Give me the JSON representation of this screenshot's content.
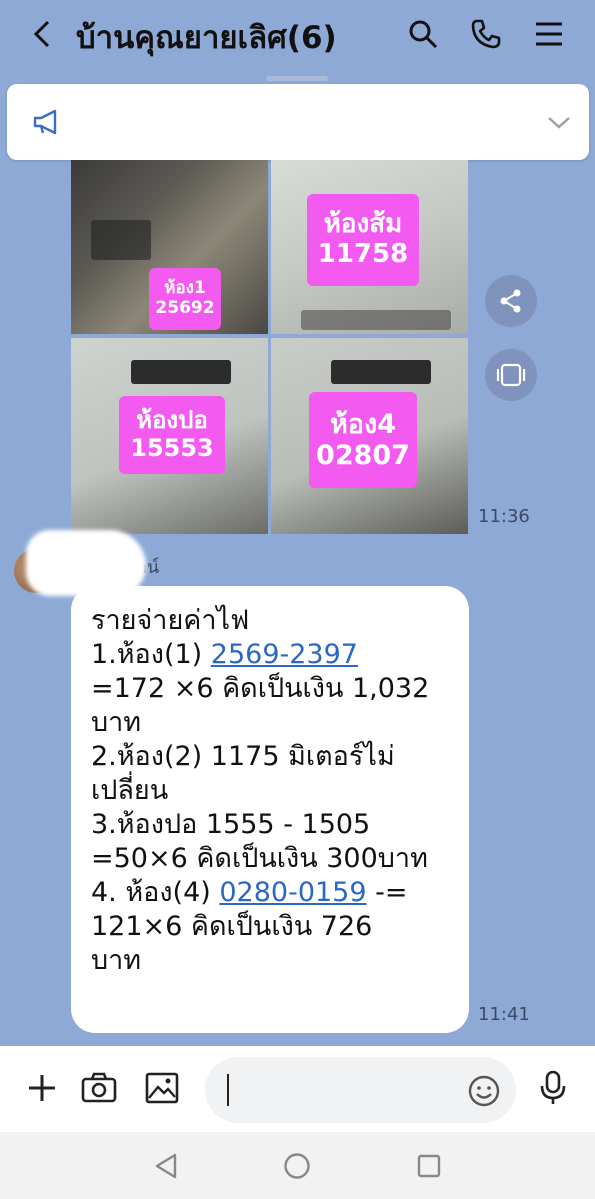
{
  "header": {
    "title": "บ้านคุณยายเลิศ(6)",
    "icons": [
      "back-icon",
      "search-icon",
      "phone-icon",
      "menu-icon"
    ]
  },
  "announcement": {
    "icons": [
      "megaphone-icon",
      "chevron-down-icon"
    ]
  },
  "photos": [
    {
      "line1": "ห้อง1",
      "line2": "25692"
    },
    {
      "line1": "ห้องส้ม",
      "line2": "11758"
    },
    {
      "line1": "ห้องปอ",
      "line2": "15553"
    },
    {
      "line1": "ห้อง4",
      "line2": "02807"
    }
  ],
  "photo_time": "11:36",
  "sender": {
    "name": "...ตน์"
  },
  "message": {
    "lines": [
      {
        "text": "รายจ่ายค่าไฟ"
      },
      {
        "prefix": "1.ห้อง(1) ",
        "link": "2569-2397"
      },
      {
        "text": "=172 ×6 คิดเป็นเงิน 1,032"
      },
      {
        "text": "บาท"
      },
      {
        "text": "2.ห้อง(2) 1175 มิเตอร์ไม่"
      },
      {
        "text": "เปลี่ยน"
      },
      {
        "text": "3.ห้องปอ 1555 - 1505"
      },
      {
        "text": "=50×6 คิดเป็นเงิน 300บาท"
      },
      {
        "prefix": "4. ห้อง(4)  ",
        "link": "0280-0159",
        "suffix": " -="
      },
      {
        "text": "121×6 คิดเป็นเงิน  726"
      },
      {
        "text": "บาท"
      }
    ],
    "time": "11:41"
  },
  "colors": {
    "background": "#8ea9d6",
    "label": "#f25af0",
    "link": "#2a67c9"
  }
}
